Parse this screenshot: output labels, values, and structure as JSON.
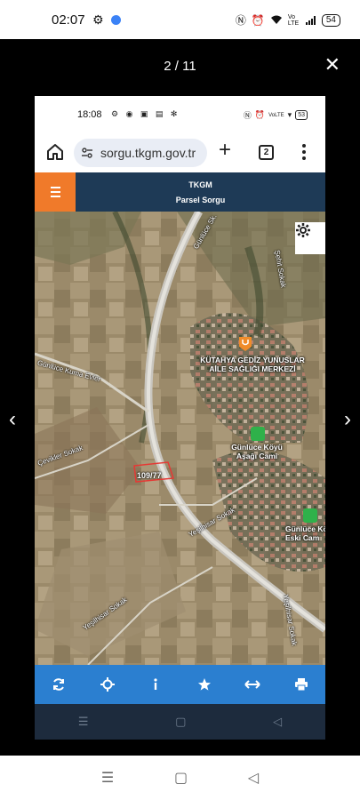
{
  "outer_status": {
    "time": "02:07",
    "battery": "54",
    "network": "Vo LTE"
  },
  "viewer": {
    "counter": "2 / 11"
  },
  "inner_status": {
    "time": "18:08",
    "battery": "53",
    "network": "VoLTE"
  },
  "browser": {
    "url": "sorgu.tkgm.gov.tr",
    "tab_count": "2"
  },
  "header": {
    "title": "TKGM",
    "subtitle": "Parsel Sorgu"
  },
  "map": {
    "road_labels": [
      "Günlüce Sk.",
      "Şehit Sokak",
      "Günlüce Kuma Evler",
      "Çevikler Sokak",
      "Yeşilhisar Sokak",
      "Yeşilhisar Sokak",
      "Yeşilhisar Sokak"
    ],
    "pois": [
      {
        "name_line1": "KÜTAHYA GEDİZ YUNUSLAR",
        "name_line2": "AİLE SAĞLIĞI MERKEZİ",
        "icon": "health-center-icon",
        "color": "#f08c2a"
      },
      {
        "name_line1": "Günlüce Köyü",
        "name_line2": "Aşağı Cami",
        "icon": "mosque-icon",
        "color": "#2fb14a"
      },
      {
        "name_line1": "Günlüce Kö",
        "name_line2": "Eski Cam",
        "icon": "mosque-icon",
        "color": "#2fb14a"
      }
    ],
    "parcel_number": "109/77",
    "parcel_highlight_color": "#e53935"
  },
  "toolbar": {
    "buttons": [
      "refresh-icon",
      "locate-icon",
      "info-icon",
      "star-icon",
      "measure-icon",
      "print-icon"
    ]
  },
  "colors": {
    "header_bg": "#1e3a56",
    "menu_accent": "#f07a2a",
    "toolbar_bg": "#2b7fd0"
  }
}
